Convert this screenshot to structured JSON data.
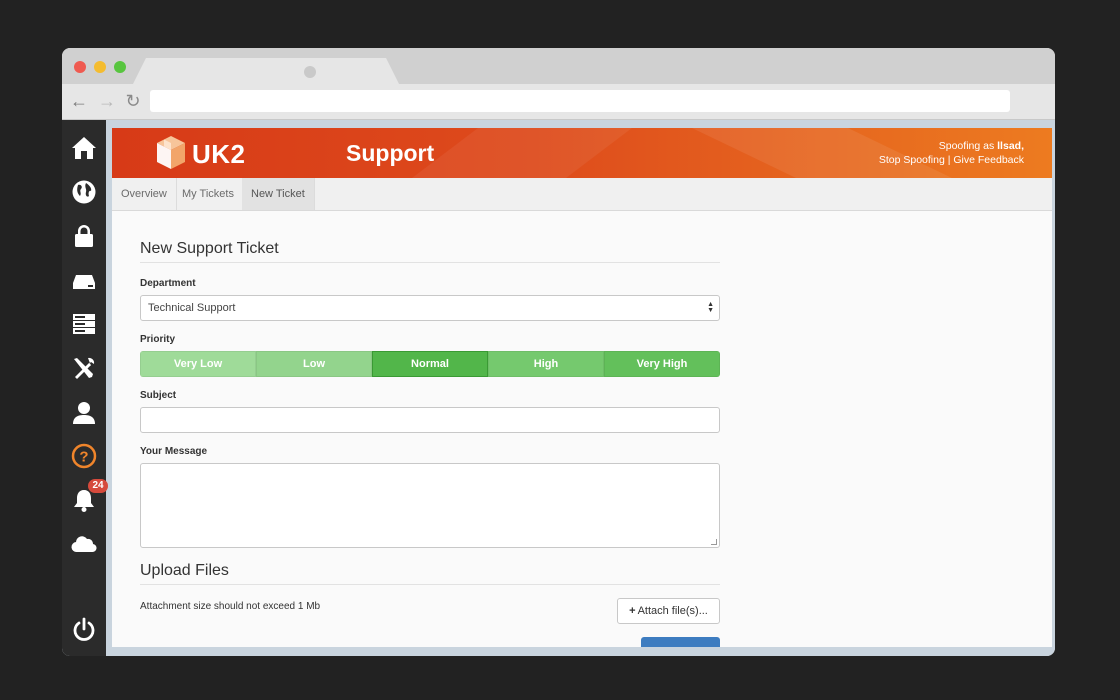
{
  "sidebar": {
    "items": [
      {
        "icon": "home-icon"
      },
      {
        "icon": "globe-icon"
      },
      {
        "icon": "lock-icon"
      },
      {
        "icon": "server-icon"
      },
      {
        "icon": "server-stack-icon"
      },
      {
        "icon": "tools-icon"
      },
      {
        "icon": "user-icon"
      },
      {
        "icon": "help-icon",
        "color": "#f0852b"
      },
      {
        "icon": "bell-icon",
        "badge": "24"
      },
      {
        "icon": "cloud-icon"
      },
      {
        "icon": "power-icon"
      }
    ]
  },
  "header": {
    "logo_text": "UK2",
    "title": "Support",
    "spoof_prefix": "Spoofing as",
    "spoof_user": "llsad,",
    "stop_spoofing": "Stop Spoofing",
    "separator": "|",
    "give_feedback": "Give Feedback",
    "colors": {
      "start": "#d73a17",
      "end": "#ed7b20"
    }
  },
  "subnav": {
    "tabs": [
      {
        "label": "Overview",
        "active": false
      },
      {
        "label": "My Tickets",
        "active": false
      },
      {
        "label": "New Ticket",
        "active": true
      }
    ]
  },
  "form": {
    "title": "New Support Ticket",
    "department_label": "Department",
    "department_value": "Technical Support",
    "priority_label": "Priority",
    "priorities": [
      "Very Low",
      "Low",
      "Normal",
      "High",
      "Very High"
    ],
    "priority_selected": "Normal",
    "subject_label": "Subject",
    "subject_value": "",
    "message_label": "Your Message",
    "message_value": "",
    "upload_title": "Upload Files",
    "attachment_hint": "Attachment size should not exceed 1 Mb",
    "attach_button": "Attach file(s)...",
    "accent_green": "#52b64a",
    "submit_color": "#3d7cc0"
  }
}
